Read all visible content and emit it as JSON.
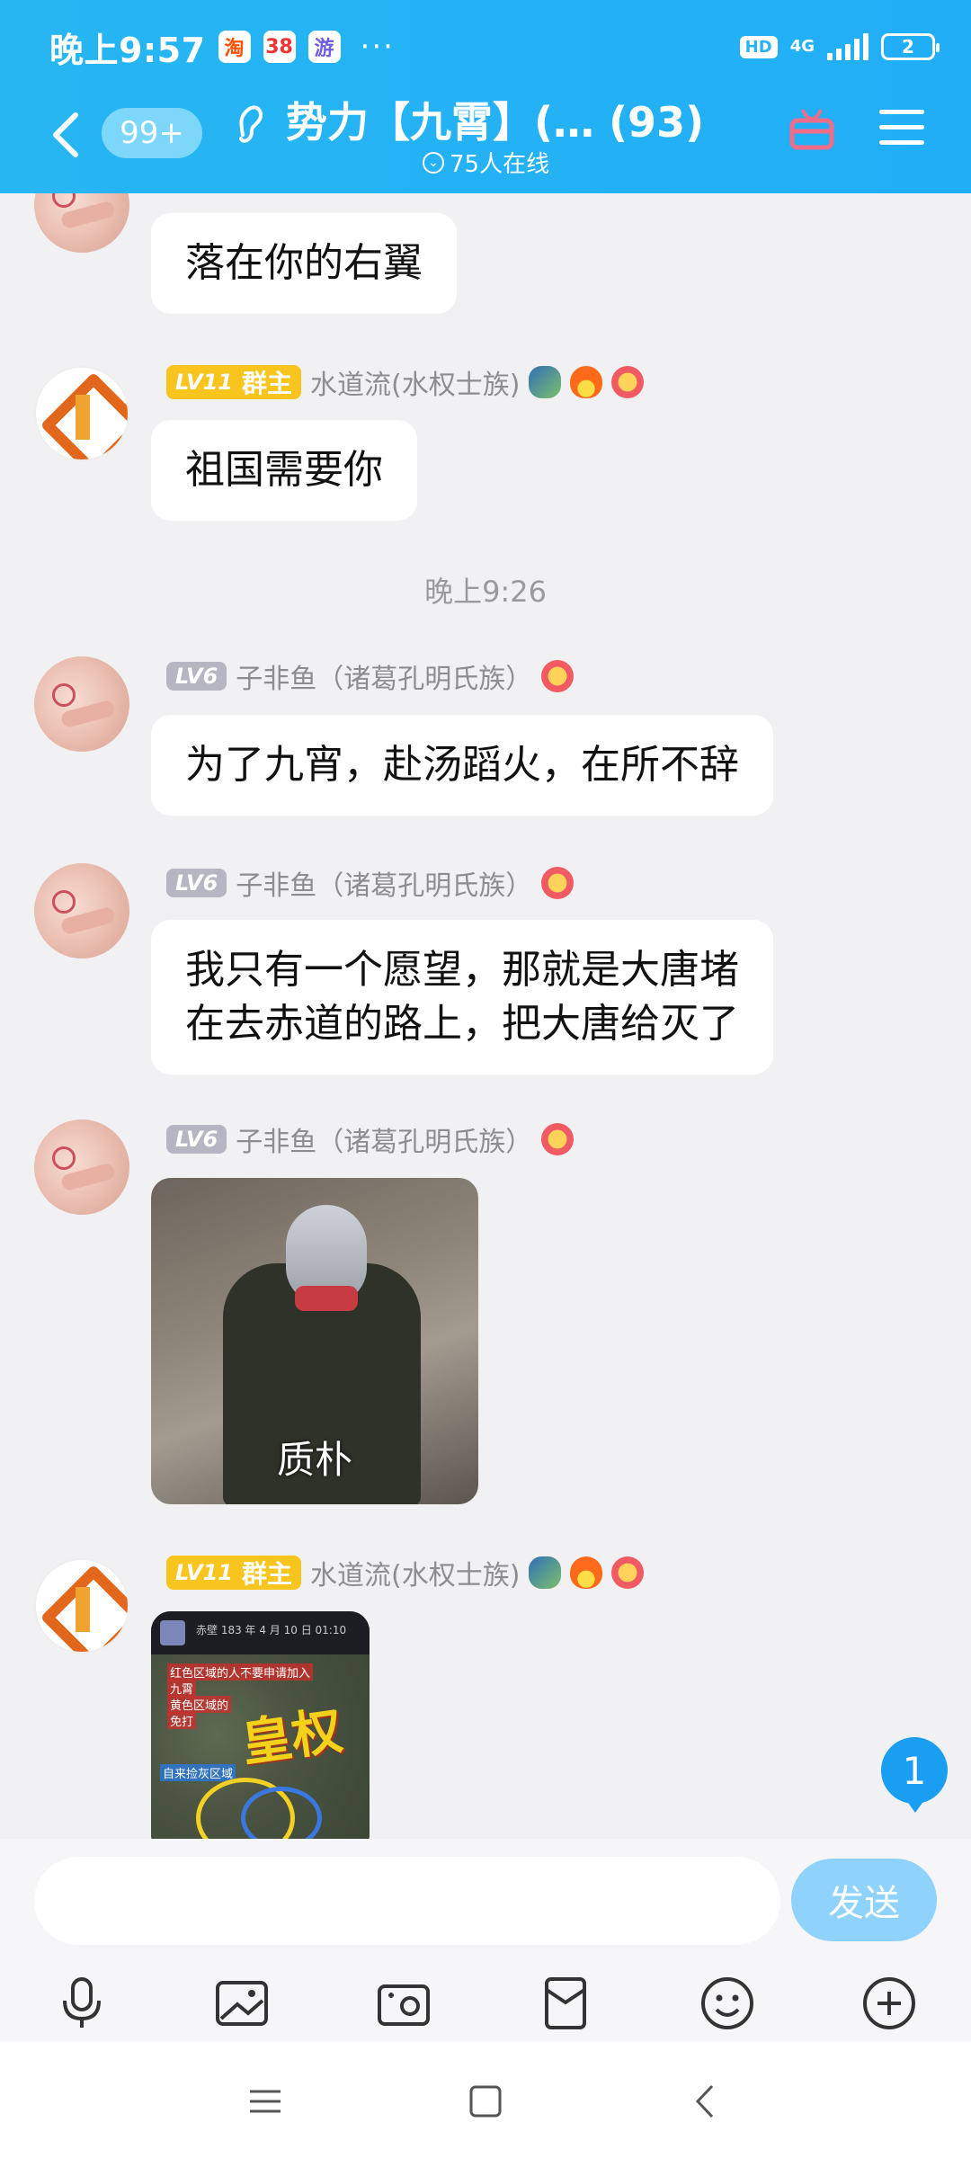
{
  "status_bar": {
    "time": "晚上9:57",
    "app_icons": [
      "淘",
      "38",
      "游"
    ],
    "more": "···",
    "hd": "HD",
    "network": "4G",
    "battery": "2"
  },
  "header": {
    "unread_count": "99+",
    "title": "势力【九霄】(… (93)",
    "online": "75人在线"
  },
  "messages": [
    {
      "text": "落在你的右翼"
    },
    {
      "level": "LV11",
      "role": "群主",
      "sender": "水道流(水权士族)",
      "text": "祖国需要你"
    },
    {
      "timestamp": "晚上9:26"
    },
    {
      "level": "LV6",
      "sender": "子非鱼（诸葛孔明氏族）",
      "text": "为了九宵，赴汤蹈火，在所不辞"
    },
    {
      "level": "LV6",
      "sender": "子非鱼（诸葛孔明氏族）",
      "text_lines": [
        "我只有一个愿望，那就是大唐堵",
        "在去赤道的路上，把大唐给灭了"
      ]
    },
    {
      "level": "LV6",
      "sender": "子非鱼（诸葛孔明氏族）",
      "image_caption": "质朴"
    },
    {
      "level": "LV11",
      "role": "群主",
      "sender": "水道流(水权士族)",
      "image_big_text": "皇权",
      "image_top": "赤壁  183 年 4 月 10 日  01:10",
      "image_notes": [
        "红色区域的人不要申请加入",
        "九霄",
        "黄色区域的",
        "免打"
      ],
      "image_blue_note": "自来捡灰区域"
    }
  ],
  "new_message_badge": "1",
  "composer": {
    "send_label": "发送"
  },
  "colors": {
    "header": "#21aef7",
    "gold_badge": "#f8c51f",
    "gray_badge": "#b6b6c2",
    "send_button": "#8fd2fb",
    "badge": "#1a9ef1"
  }
}
